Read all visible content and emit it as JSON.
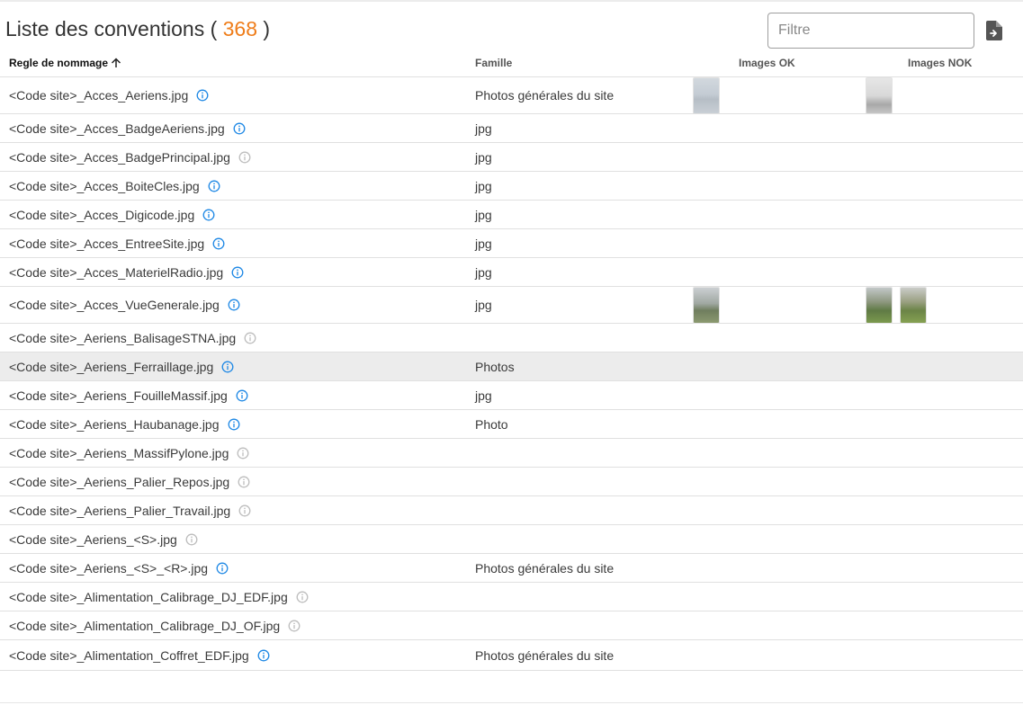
{
  "header": {
    "title_prefix": "Liste des conventions ( ",
    "count": "368",
    "title_suffix": " )",
    "filter_placeholder": "Filtre",
    "export_icon": "file-export-icon"
  },
  "colors": {
    "count_accent": "#ef7d1a",
    "info_active": "#1e88e5",
    "info_inactive": "#bdbdbd",
    "selected_row": "#ececec"
  },
  "table": {
    "columns": [
      {
        "label": "Regle de nommage",
        "sort": "ascending"
      },
      {
        "label": "Famille"
      },
      {
        "label": "Images OK"
      },
      {
        "label": "Images NOK"
      }
    ],
    "rows": [
      {
        "name": "<Code site>_Acces_Aeriens.jpg",
        "info": "active",
        "famille": "Photos générales du site",
        "images_ok": [
          "t-sky"
        ],
        "images_nok": [
          "t-tower"
        ]
      },
      {
        "name": "<Code site>_Acces_BadgeAeriens.jpg",
        "info": "active",
        "famille": "jpg",
        "images_ok": [],
        "images_nok": []
      },
      {
        "name": "<Code site>_Acces_BadgePrincipal.jpg",
        "info": "inactive",
        "famille": "jpg",
        "images_ok": [],
        "images_nok": []
      },
      {
        "name": "<Code site>_Acces_BoiteCles.jpg",
        "info": "active",
        "famille": "jpg",
        "images_ok": [],
        "images_nok": []
      },
      {
        "name": "<Code site>_Acces_Digicode.jpg",
        "info": "active",
        "famille": "jpg",
        "images_ok": [],
        "images_nok": []
      },
      {
        "name": "<Code site>_Acces_EntreeSite.jpg",
        "info": "active",
        "famille": "jpg",
        "images_ok": [],
        "images_nok": []
      },
      {
        "name": "<Code site>_Acces_MaterielRadio.jpg",
        "info": "active",
        "famille": "jpg",
        "images_ok": [],
        "images_nok": []
      },
      {
        "name": "<Code site>_Acces_VueGenerale.jpg",
        "info": "active",
        "famille": "jpg",
        "images_ok": [
          "t-field"
        ],
        "images_nok": [
          "t-green",
          "t-green2"
        ]
      },
      {
        "name": "<Code site>_Aeriens_BalisageSTNA.jpg",
        "info": "inactive",
        "famille": "",
        "images_ok": [],
        "images_nok": []
      },
      {
        "name": "<Code site>_Aeriens_Ferraillage.jpg",
        "info": "active",
        "famille": "Photos",
        "images_ok": [],
        "images_nok": [],
        "selected": true
      },
      {
        "name": "<Code site>_Aeriens_FouilleMassif.jpg",
        "info": "active",
        "famille": "jpg",
        "images_ok": [],
        "images_nok": []
      },
      {
        "name": "<Code site>_Aeriens_Haubanage.jpg",
        "info": "active",
        "famille": "Photo",
        "images_ok": [],
        "images_nok": []
      },
      {
        "name": "<Code site>_Aeriens_MassifPylone.jpg",
        "info": "inactive",
        "famille": "",
        "images_ok": [],
        "images_nok": []
      },
      {
        "name": "<Code site>_Aeriens_Palier_Repos.jpg",
        "info": "inactive",
        "famille": "",
        "images_ok": [],
        "images_nok": []
      },
      {
        "name": "<Code site>_Aeriens_Palier_Travail.jpg",
        "info": "inactive",
        "famille": "",
        "images_ok": [],
        "images_nok": []
      },
      {
        "name": "<Code site>_Aeriens_<S>.jpg",
        "info": "inactive",
        "famille": "",
        "images_ok": [],
        "images_nok": []
      },
      {
        "name": "<Code site>_Aeriens_<S>_<R>.jpg",
        "info": "active",
        "famille": "Photos générales du site",
        "images_ok": [],
        "images_nok": []
      },
      {
        "name": "<Code site>_Alimentation_Calibrage_DJ_EDF.jpg",
        "info": "inactive",
        "famille": "",
        "images_ok": [],
        "images_nok": []
      },
      {
        "name": "<Code site>_Alimentation_Calibrage_DJ_OF.jpg",
        "info": "inactive",
        "famille": "",
        "images_ok": [],
        "images_nok": []
      },
      {
        "name": "<Code site>_Alimentation_Coffret_EDF.jpg",
        "info": "active",
        "famille": "Photos générales du site",
        "images_ok": [],
        "images_nok": []
      }
    ]
  }
}
